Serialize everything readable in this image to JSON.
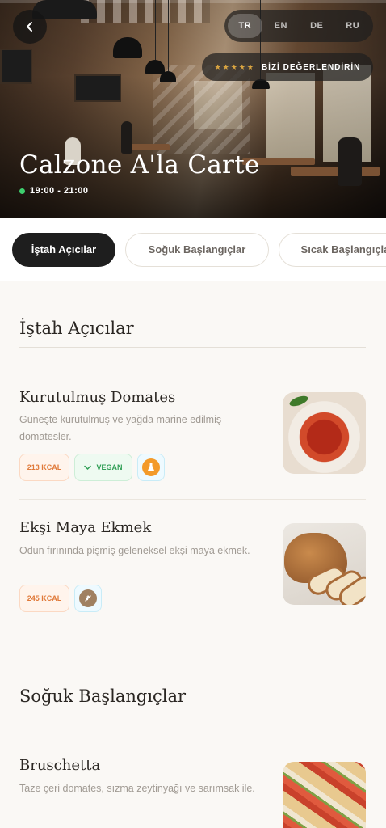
{
  "header": {
    "restaurant_name": "Calzone A'la Carte",
    "hours": "19:00 - 21:00",
    "status_color": "#3ecf6e",
    "rate_stars": "★★★★★",
    "rate_label": "BİZİ DEĞERLENDİRİN"
  },
  "languages": [
    {
      "code": "TR",
      "active": true
    },
    {
      "code": "EN",
      "active": false
    },
    {
      "code": "DE",
      "active": false
    },
    {
      "code": "RU",
      "active": false
    }
  ],
  "categories": [
    {
      "label": "İştah Açıcılar",
      "active": true
    },
    {
      "label": "Soğuk Başlangıçlar",
      "active": false
    },
    {
      "label": "Sıcak Başlangıçlar",
      "active": false
    }
  ],
  "sections": [
    {
      "title": "İştah Açıcılar",
      "items": [
        {
          "name": "Kurutulmuş Domates",
          "description": "Güneşte kurutulmuş ve yağda marine edilmiş domatesler.",
          "kcal": "213 KCAL",
          "vegan": "VEGAN",
          "allergen_icon": "allergen-flask-icon"
        },
        {
          "name": "Ekşi Maya Ekmek",
          "description": "Odun fırınında pişmiş geleneksel ekşi maya ekmek.",
          "kcal": "245 KCAL",
          "allergen_icon": "gluten-wheat-icon"
        }
      ]
    },
    {
      "title": "Soğuk Başlangıçlar",
      "items": [
        {
          "name": "Bruschetta",
          "description": "Taze çeri domates, sızma zeytinyağı ve sarımsak ile."
        }
      ]
    }
  ],
  "colors": {
    "accent_dark": "#1e1e1e",
    "kcal_text": "#e07a3a",
    "vegan_text": "#2f9e55",
    "star": "#d9a441"
  }
}
